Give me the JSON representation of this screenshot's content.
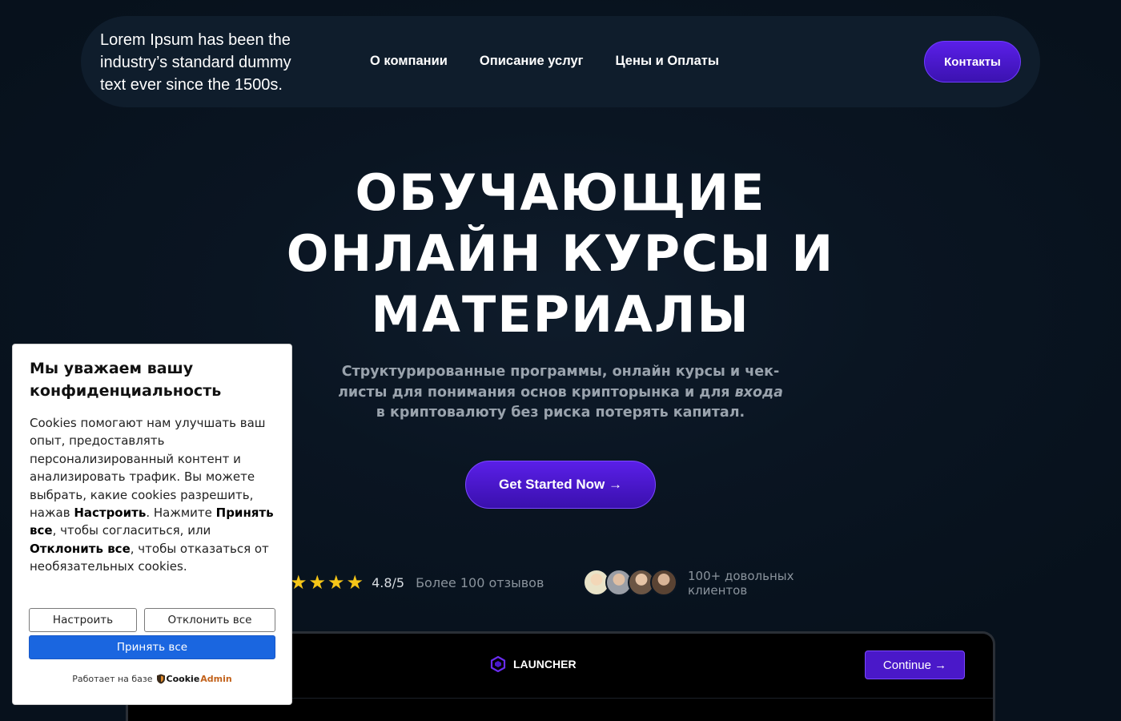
{
  "header": {
    "brand_text": "Lorem Ipsum has been the industry’s standard dummy text ever since the 1500s.",
    "nav": [
      {
        "label": "О компании"
      },
      {
        "label": "Описание услуг"
      },
      {
        "label": "Цены и Оплаты"
      }
    ],
    "contacts_label": "Контакты"
  },
  "hero": {
    "title_line1": "ОБУЧАЮЩИЕ",
    "title_line2": "ОНЛАЙН КУРСЫ И",
    "title_line3": "МАТЕРИАЛЫ",
    "subtitle_part1": "Структурированные программы, онлайн курсы и чек-листы для понимания основ крипторынка и для ",
    "subtitle_emphasis": "входа",
    "subtitle_part2": " в криптовалюту без риска потерять капитал.",
    "cta_label": "Get Started Now →"
  },
  "rating": {
    "stars": 4,
    "score": "4.8/5",
    "reviews_text": "Более 100 отзывов",
    "clients_text": "100+ довольных клиентов",
    "avatar_count": 4
  },
  "launcher": {
    "name": "LAUNCHER",
    "continue_label": "Continue →"
  },
  "cookie_banner": {
    "title": "Мы уважаем вашу конфиденциальность",
    "body_1": "Cookies помогают нам улучшать ваш опыт, предоставлять персонализированный контент и анализировать трафик. Вы можете выбрать, какие cookies разрешить, нажав ",
    "body_bold_configure": "Настроить",
    "body_2": ". Нажмите ",
    "body_bold_accept": "Принять все",
    "body_3": ", чтобы согласиться, или ",
    "body_bold_reject": "Отклонить все",
    "body_4": ", чтобы отказаться от необязательных cookies.",
    "configure_label": "Настроить",
    "reject_label": "Отклонить все",
    "accept_label": "Принять все",
    "powered_by": "Работает на базе",
    "brand_part1": "Cookie",
    "brand_part2": "Admin"
  },
  "colors": {
    "background": "#07111c",
    "accent": "#5a1fe8",
    "star": "#f5c518",
    "accept_button": "#1a66e0"
  }
}
